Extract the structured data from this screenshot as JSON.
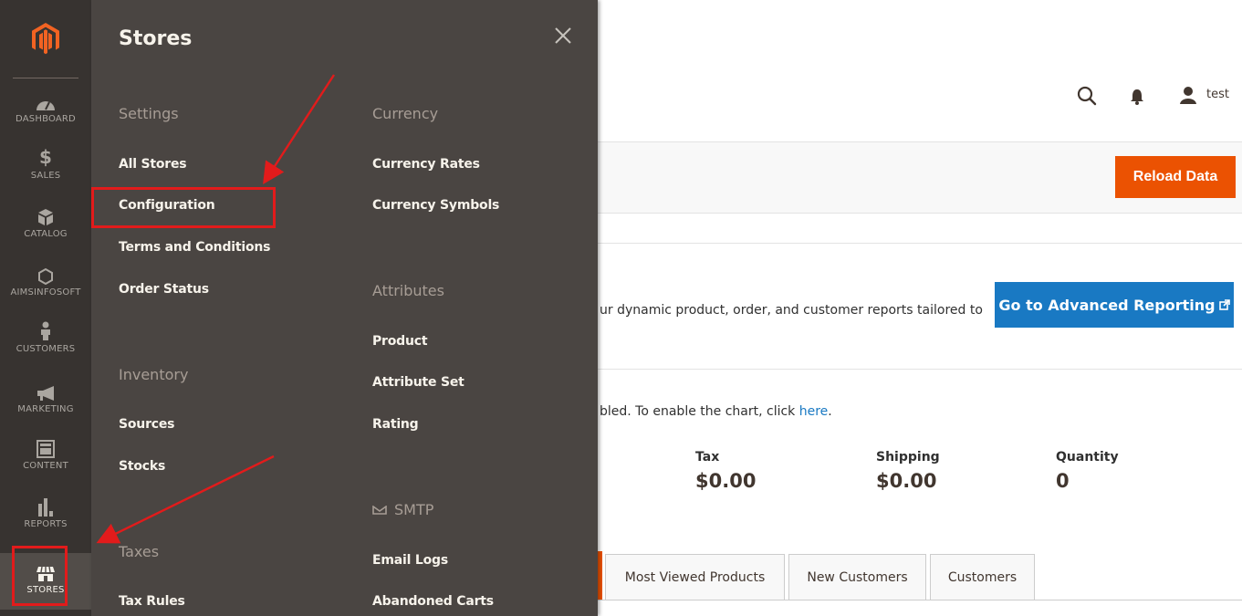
{
  "nav": {
    "items": [
      {
        "label": "DASHBOARD",
        "icon": "dashboard-icon"
      },
      {
        "label": "SALES",
        "icon": "dollar-icon"
      },
      {
        "label": "CATALOG",
        "icon": "box-icon"
      },
      {
        "label": "AIMSINFOSOFT",
        "icon": "hexagon-icon"
      },
      {
        "label": "CUSTOMERS",
        "icon": "person-icon"
      },
      {
        "label": "MARKETING",
        "icon": "megaphone-icon"
      },
      {
        "label": "CONTENT",
        "icon": "content-icon"
      },
      {
        "label": "REPORTS",
        "icon": "bar-chart-icon"
      },
      {
        "label": "STORES",
        "icon": "store-icon"
      }
    ]
  },
  "flyout": {
    "title": "Stores",
    "settings": {
      "title": "Settings",
      "links": [
        "All Stores",
        "Configuration",
        "Terms and Conditions",
        "Order Status"
      ]
    },
    "inventory": {
      "title": "Inventory",
      "links": [
        "Sources",
        "Stocks"
      ]
    },
    "taxes": {
      "title": "Taxes",
      "links": [
        "Tax Rules"
      ]
    },
    "currency": {
      "title": "Currency",
      "links": [
        "Currency Rates",
        "Currency Symbols"
      ]
    },
    "attributes": {
      "title": "Attributes",
      "links": [
        "Product",
        "Attribute Set",
        "Rating"
      ]
    },
    "smtp": {
      "title": "SMTP",
      "links": [
        "Email Logs",
        "Abandoned Carts"
      ]
    }
  },
  "header": {
    "user": "test"
  },
  "toolbar": {
    "reload_label": "Reload Data"
  },
  "advanced": {
    "text": "ur dynamic product, order, and customer reports tailored to",
    "button_label": "Go to Advanced Reporting"
  },
  "chart_notice": {
    "text": "bled. To enable the chart, click ",
    "link": "here",
    "suffix": "."
  },
  "stats": [
    {
      "label": "Tax",
      "value": "$0.00"
    },
    {
      "label": "Shipping",
      "value": "$0.00"
    },
    {
      "label": "Quantity",
      "value": "0"
    }
  ],
  "tabs": [
    "Most Viewed Products",
    "New Customers",
    "Customers"
  ],
  "colors": {
    "nav_bg": "#373330",
    "flyout_bg": "#4a4542",
    "accent_orange": "#eb5202",
    "accent_blue": "#1979c3",
    "annotation_red": "#e21b1b"
  }
}
